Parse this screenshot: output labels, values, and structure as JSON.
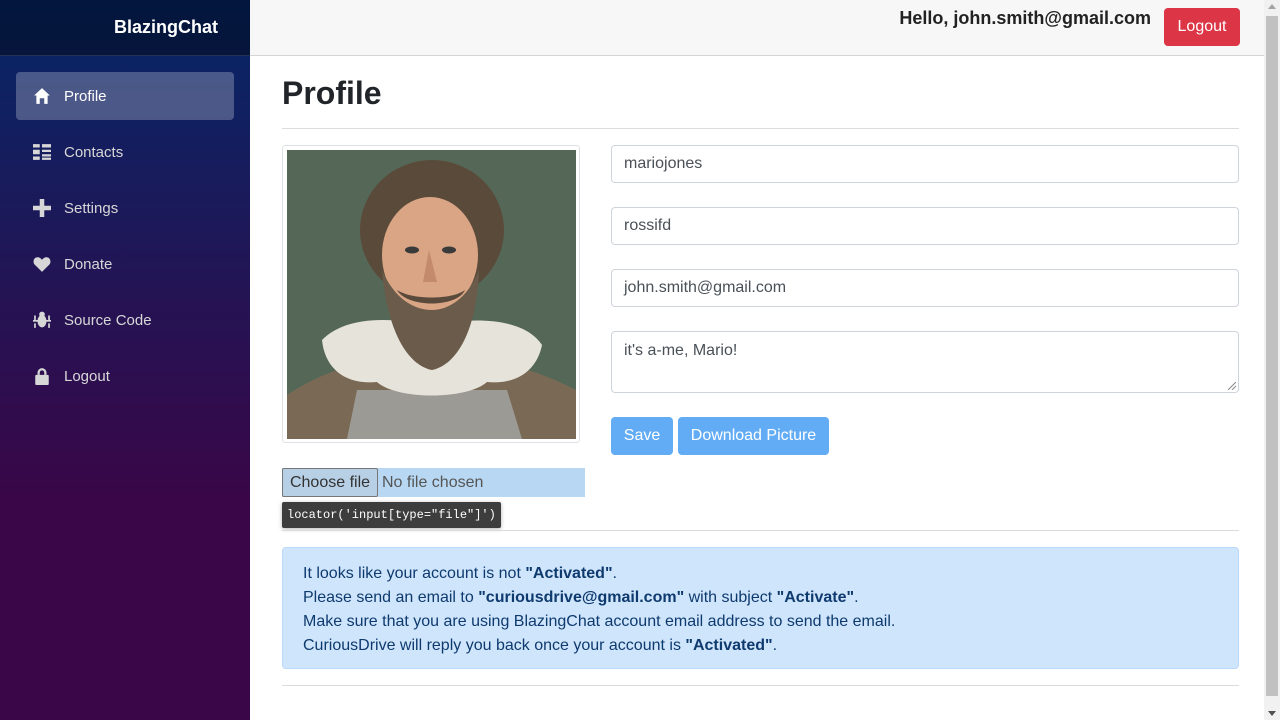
{
  "brand": "BlazingChat",
  "sidebar": {
    "items": [
      {
        "label": "Profile",
        "icon": "home-icon"
      },
      {
        "label": "Contacts",
        "icon": "list-icon"
      },
      {
        "label": "Settings",
        "icon": "plus-icon"
      },
      {
        "label": "Donate",
        "icon": "heart-icon"
      },
      {
        "label": "Source Code",
        "icon": "bug-icon"
      },
      {
        "label": "Logout",
        "icon": "lock-icon"
      }
    ],
    "active": "Profile"
  },
  "header": {
    "greeting": "Hello, john.smith@gmail.com",
    "logout_label": "Logout"
  },
  "main": {
    "title": "Profile",
    "fields": {
      "first_name": "mariojones",
      "last_name": "rossifd",
      "email": "john.smith@gmail.com",
      "about": "it's a-me, Mario!"
    },
    "save_label": "Save",
    "download_label": "Download Picture",
    "file_input": {
      "button_label": "Choose file",
      "status": "No file chosen"
    },
    "tooltip": "locator('input[type=\"file\"]')",
    "alert": {
      "line1_pre": "It looks like your account is not ",
      "line1_bold": "\"Activated\"",
      "line1_post": ".",
      "line2_pre": "Please send an email to ",
      "line2_bold1": "\"curiousdrive@gmail.com\"",
      "line2_mid": " with subject ",
      "line2_bold2": "\"Activate\"",
      "line2_post": ".",
      "line3": "Make sure that you are using BlazingChat account email address to send the email.",
      "line4_pre": "CuriousDrive will reply you back once your account is ",
      "line4_bold": "\"Activated\"",
      "line4_post": "."
    }
  },
  "colors": {
    "sidebar_top": "#052767",
    "sidebar_bottom": "#3a0647",
    "logout_button": "#dc3545",
    "primary_button": "#62acf5",
    "alert_bg": "#cfe5fc"
  }
}
